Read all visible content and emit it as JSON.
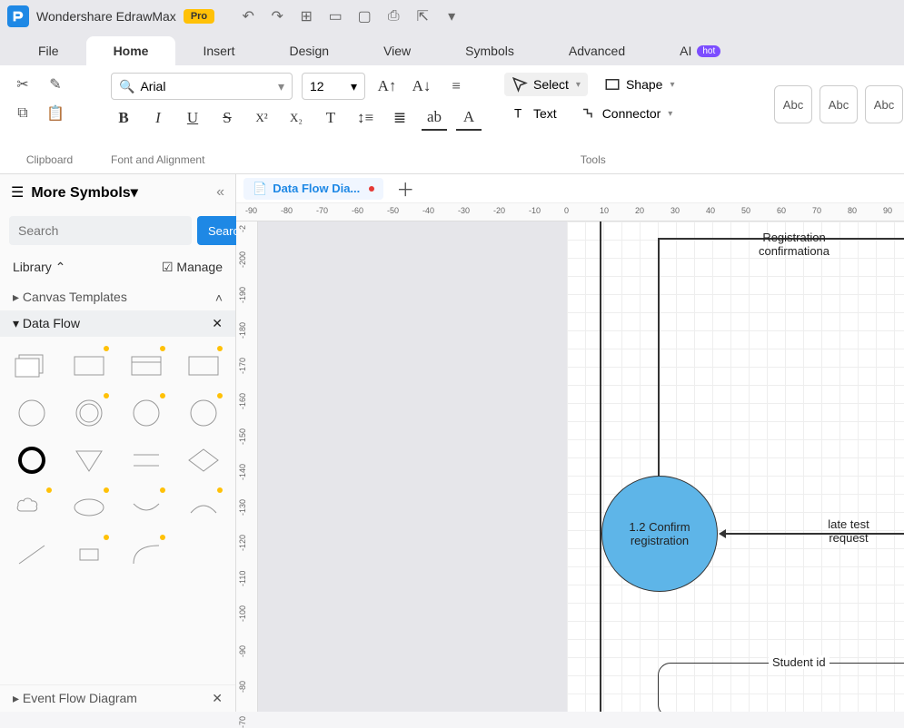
{
  "app": {
    "title": "Wondershare EdrawMax",
    "pro": "Pro"
  },
  "menu": {
    "file": "File",
    "home": "Home",
    "insert": "Insert",
    "design": "Design",
    "view": "View",
    "symbols": "Symbols",
    "advanced": "Advanced",
    "ai": "AI",
    "ai_badge": "hot"
  },
  "ribbon": {
    "clipboard_label": "Clipboard",
    "font_label": "Font and Alignment",
    "tools_label": "Tools",
    "font_name": "Arial",
    "font_size": "12",
    "select": "Select",
    "shape": "Shape",
    "text": "Text",
    "connector": "Connector",
    "abc": "Abc"
  },
  "sidebar": {
    "title": "More Symbols",
    "search_placeholder": "Search",
    "search_btn": "Search",
    "library": "Library",
    "manage": "Manage",
    "canvas_templates": "Canvas Templates",
    "data_flow": "Data Flow",
    "event_flow": "Event Flow Diagram"
  },
  "doc": {
    "tab_name": "Data Flow Dia..."
  },
  "ruler_h": [
    "-90",
    "-80",
    "-70",
    "-60",
    "-50",
    "-40",
    "-30",
    "-20",
    "-10",
    "0",
    "10",
    "20",
    "30",
    "40",
    "50",
    "60",
    "70",
    "80",
    "90"
  ],
  "ruler_v": [
    "-2",
    "-200",
    "-190",
    "-180",
    "-170",
    "-160",
    "-150",
    "-140",
    "-130",
    "-120",
    "-110",
    "-100",
    "-90",
    "-80",
    "-70"
  ],
  "diagram": {
    "node1": "1.2 Confirm registration",
    "label_reg": "Registration confirmationa",
    "label_late": "late test request",
    "label_student": "Student id"
  }
}
